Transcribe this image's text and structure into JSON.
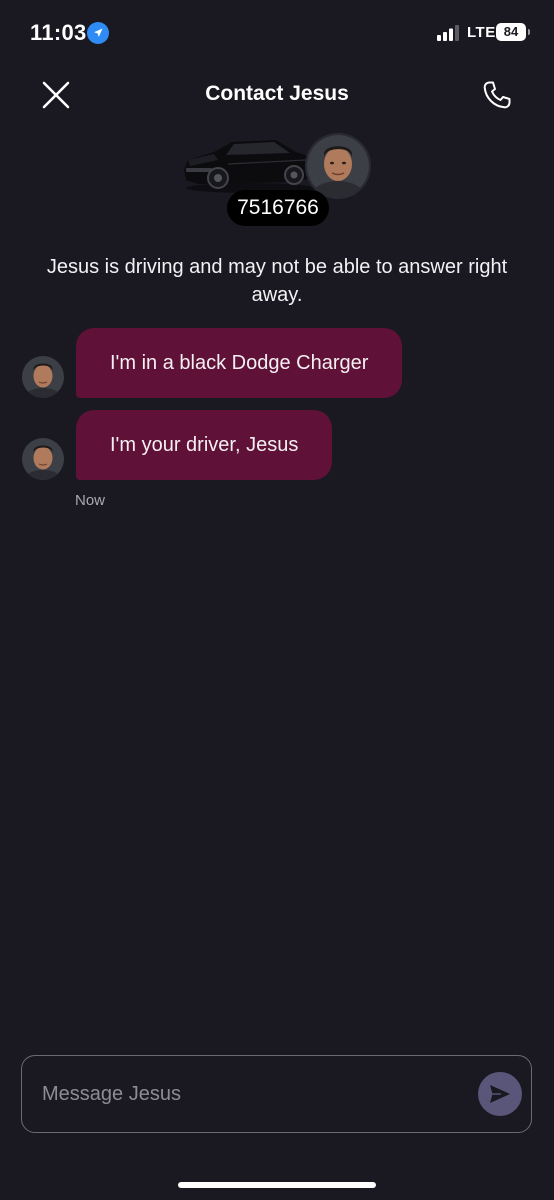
{
  "status_bar": {
    "time": "11:03",
    "network": "LTE",
    "battery": "84",
    "location_icon": "location-arrow-icon",
    "signal_icon": "cellular-signal-icon"
  },
  "header": {
    "title": "Contact Jesus",
    "close_icon": "close-icon",
    "call_icon": "phone-icon"
  },
  "vehicle": {
    "license_plate": "7516766",
    "car_color": "#0c0c0f"
  },
  "notice": "Jesus is driving and may not be able to answer right away.",
  "messages": [
    {
      "text": "I'm in a black Dodge Charger"
    },
    {
      "text": "I'm your driver, Jesus"
    }
  ],
  "message_timestamp": "Now",
  "composer": {
    "placeholder": "Message Jesus",
    "send_icon": "send-icon"
  },
  "colors": {
    "background": "#1a1921",
    "bubble": "#5f1138",
    "send_button": "#5a5679",
    "location_blue": "#2f8cf5"
  }
}
